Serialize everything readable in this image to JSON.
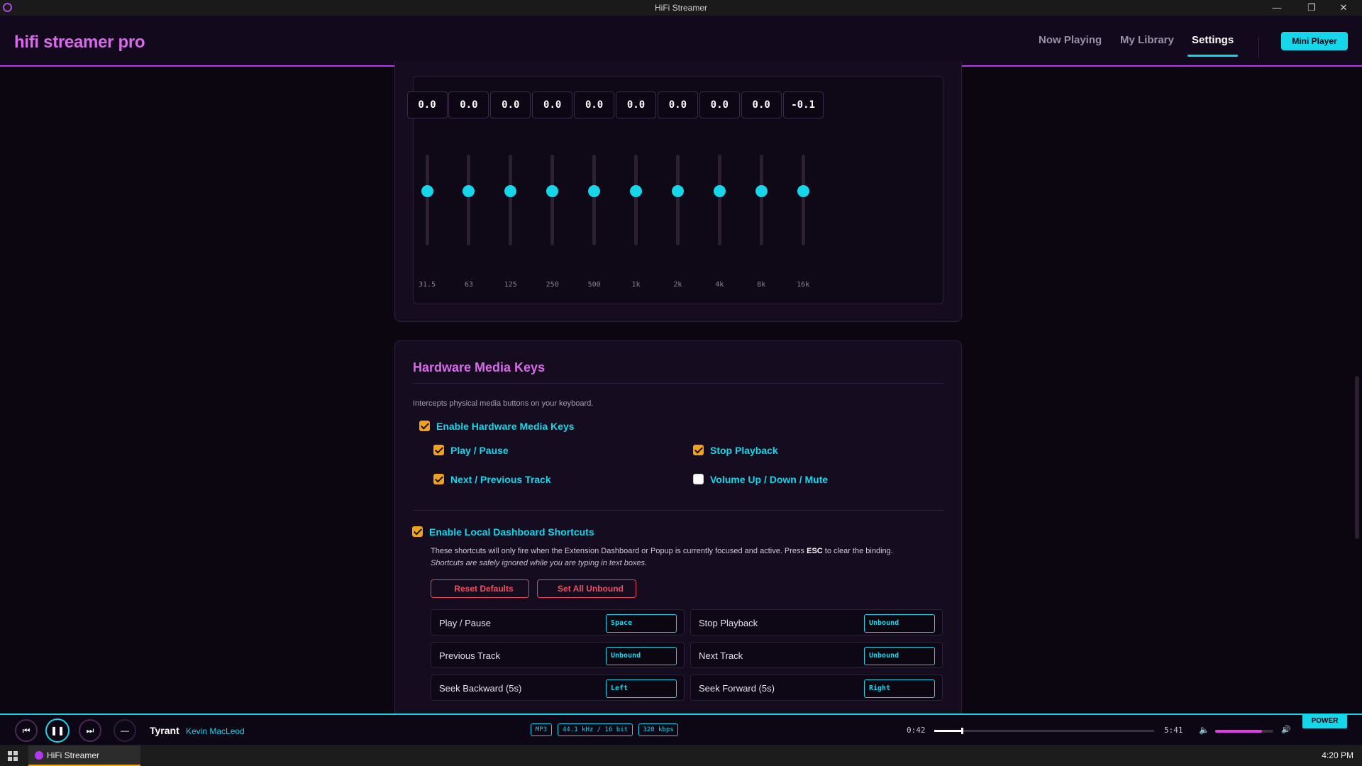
{
  "window": {
    "title": "HiFi Streamer"
  },
  "header": {
    "brand": "hifi streamer pro",
    "tabs": [
      {
        "label": "Now Playing"
      },
      {
        "label": "My Library"
      },
      {
        "label": "Settings",
        "active": true
      }
    ],
    "mini_player_label": "Mini Player"
  },
  "equalizer": {
    "bands": [
      {
        "label": "31.5",
        "value": "0.0",
        "level": 0.0
      },
      {
        "label": "63",
        "value": "0.0",
        "level": 0.0
      },
      {
        "label": "125",
        "value": "0.0",
        "level": 0.0
      },
      {
        "label": "250",
        "value": "0.0",
        "level": 0.0
      },
      {
        "label": "500",
        "value": "0.0",
        "level": 0.0
      },
      {
        "label": "1k",
        "value": "0.0",
        "level": 0.0
      },
      {
        "label": "2k",
        "value": "0.0",
        "level": 0.0
      },
      {
        "label": "4k",
        "value": "0.0",
        "level": 0.0
      },
      {
        "label": "8k",
        "value": "0.0",
        "level": 0.0
      },
      {
        "label": "16k",
        "value": "-0.1",
        "level": -0.1
      }
    ]
  },
  "hardware_keys": {
    "title": "Hardware Media Keys",
    "description": "Intercepts physical media buttons on your keyboard.",
    "enable_label": "Enable Hardware Media Keys",
    "options": [
      {
        "label": "Play / Pause",
        "checked": true
      },
      {
        "label": "Stop Playback",
        "checked": true
      },
      {
        "label": "Next / Previous Track",
        "checked": true
      },
      {
        "label": "Volume Up / Down / Mute",
        "checked": false
      }
    ]
  },
  "local_shortcuts": {
    "enable_label": "Enable Local Dashboard Shortcuts",
    "desc_before": "These shortcuts will only fire when the Extension Dashboard or Popup is currently focused and active. Press ",
    "desc_key": "ESC",
    "desc_after": " to clear the binding.",
    "note": "Shortcuts are safely ignored while you are typing in text boxes.",
    "reset_label": "Reset Defaults",
    "unbind_label": "Set All Unbound",
    "rows": [
      {
        "label": "Play / Pause",
        "key": "Space"
      },
      {
        "label": "Stop Playback",
        "key": "Unbound"
      },
      {
        "label": "Previous Track",
        "key": "Unbound"
      },
      {
        "label": "Next Track",
        "key": "Unbound"
      },
      {
        "label": "Seek Backward (5s)",
        "key": "Left"
      },
      {
        "label": "Seek Forward (5s)",
        "key": "Right"
      }
    ]
  },
  "player": {
    "track_title": "Tyrant",
    "artist": "Kevin MacLeod",
    "badges": [
      "MP3",
      "44.1 kHz / 16 bit",
      "320 kbps"
    ],
    "elapsed": "0:42",
    "duration": "5:41",
    "progress": 0.123,
    "volume": 0.8,
    "power_label": "POWER"
  },
  "taskbar": {
    "task_label": "HiFi Streamer",
    "clock": "4:20 PM"
  },
  "colors": {
    "accent_cyan": "#16d7ea",
    "accent_magenta": "#d86be8",
    "checkbox": "#f0a21c",
    "danger": "#f04f62"
  }
}
